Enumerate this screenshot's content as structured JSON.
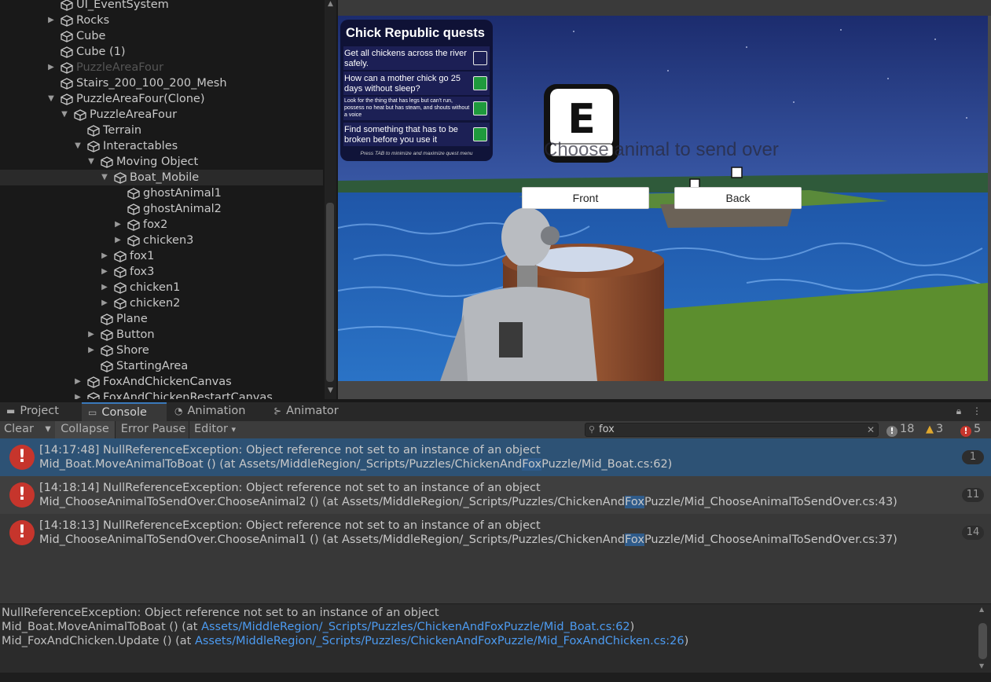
{
  "hierarchy": {
    "items": [
      {
        "label": "UI_EventSystem",
        "indent": 0,
        "arrow": "",
        "dim": false,
        "selected": false
      },
      {
        "label": "Rocks",
        "indent": 0,
        "arrow": "▶",
        "dim": false,
        "selected": false
      },
      {
        "label": "Cube",
        "indent": 0,
        "arrow": "",
        "dim": false,
        "selected": false
      },
      {
        "label": "Cube (1)",
        "indent": 0,
        "arrow": "",
        "dim": false,
        "selected": false
      },
      {
        "label": "PuzzleAreaFour",
        "indent": 0,
        "arrow": "▶",
        "dim": true,
        "selected": false
      },
      {
        "label": "Stairs_200_100_200_Mesh",
        "indent": 0,
        "arrow": "",
        "dim": false,
        "selected": false
      },
      {
        "label": "PuzzleAreaFour(Clone)",
        "indent": 0,
        "arrow": "▼",
        "dim": false,
        "selected": false
      },
      {
        "label": "PuzzleAreaFour",
        "indent": 1,
        "arrow": "▼",
        "dim": false,
        "selected": false
      },
      {
        "label": "Terrain",
        "indent": 2,
        "arrow": "",
        "dim": false,
        "selected": false
      },
      {
        "label": "Interactables",
        "indent": 2,
        "arrow": "▼",
        "dim": false,
        "selected": false
      },
      {
        "label": "Moving Object",
        "indent": 3,
        "arrow": "▼",
        "dim": false,
        "selected": false
      },
      {
        "label": "Boat_Mobile",
        "indent": 4,
        "arrow": "▼",
        "dim": false,
        "selected": true
      },
      {
        "label": "ghostAnimal1",
        "indent": 5,
        "arrow": "",
        "dim": false,
        "selected": false
      },
      {
        "label": "ghostAnimal2",
        "indent": 5,
        "arrow": "",
        "dim": false,
        "selected": false
      },
      {
        "label": "fox2",
        "indent": 5,
        "arrow": "▶",
        "dim": false,
        "selected": false
      },
      {
        "label": "chicken3",
        "indent": 5,
        "arrow": "▶",
        "dim": false,
        "selected": false
      },
      {
        "label": "fox1",
        "indent": 4,
        "arrow": "▶",
        "dim": false,
        "selected": false
      },
      {
        "label": "fox3",
        "indent": 4,
        "arrow": "▶",
        "dim": false,
        "selected": false
      },
      {
        "label": "chicken1",
        "indent": 4,
        "arrow": "▶",
        "dim": false,
        "selected": false
      },
      {
        "label": "chicken2",
        "indent": 4,
        "arrow": "▶",
        "dim": false,
        "selected": false
      },
      {
        "label": "Plane",
        "indent": 3,
        "arrow": "",
        "dim": false,
        "selected": false
      },
      {
        "label": "Button",
        "indent": 3,
        "arrow": "▶",
        "dim": false,
        "selected": false
      },
      {
        "label": "Shore",
        "indent": 3,
        "arrow": "▶",
        "dim": false,
        "selected": false
      },
      {
        "label": "StartingArea",
        "indent": 3,
        "arrow": "",
        "dim": false,
        "selected": false
      },
      {
        "label": "FoxAndChickenCanvas",
        "indent": 2,
        "arrow": "▶",
        "dim": false,
        "selected": false
      },
      {
        "label": "FoxAndChickenRestartCanvas",
        "indent": 2,
        "arrow": "▶",
        "dim": false,
        "selected": false
      }
    ]
  },
  "game": {
    "quest_panel": {
      "title": "Chick Republic quests",
      "quests": [
        {
          "text": "Get all chickens across the river safely.",
          "checked": false,
          "small": false
        },
        {
          "text": "How can a mother chick go 25 days without sleep?",
          "checked": true,
          "small": false
        },
        {
          "text": "Look for the thing that has legs but can't run, possess no heat but has steam, and shouts without a voice",
          "checked": true,
          "small": true
        },
        {
          "text": "Find something that has to be broken before you use it",
          "checked": true,
          "small": false
        }
      ],
      "hint": "Press TAB to minimize and maximize quest menu"
    },
    "key_prompt": "E",
    "prompt_text": "Choose animal to send over",
    "front_button": "Front",
    "back_button": "Back"
  },
  "tabs": [
    {
      "label": "Project",
      "icon": "folder-icon",
      "glyph": "▬",
      "active": false
    },
    {
      "label": "Console",
      "icon": "console-icon",
      "glyph": "▭",
      "active": true
    },
    {
      "label": "Animation",
      "icon": "animation-icon",
      "glyph": "◔",
      "active": false
    },
    {
      "label": "Animator",
      "icon": "animator-icon",
      "glyph": "⊱",
      "active": false
    }
  ],
  "toolbar": {
    "clear": "Clear",
    "collapse": "Collapse",
    "error_pause": "Error Pause",
    "editor": "Editor",
    "search_value": "fox",
    "info_count": "18",
    "warn_count": "3",
    "error_count": "5"
  },
  "logs": [
    {
      "line1": "[14:17:48] NullReferenceException: Object reference not set to an instance of an object",
      "line2_pre": "Mid_Boat.MoveAnimalToBoat () (at Assets/MiddleRegion/_Scripts/Puzzles/ChickenAnd",
      "line2_hl": "Fox",
      "line2_post": "Puzzle/Mid_Boat.cs:62)",
      "count": "1"
    },
    {
      "line1": "[14:18:14] NullReferenceException: Object reference not set to an instance of an object",
      "line2_pre": "Mid_ChooseAnimalToSendOver.ChooseAnimal2 () (at Assets/MiddleRegion/_Scripts/Puzzles/ChickenAnd",
      "line2_hl": "Fox",
      "line2_post": "Puzzle/Mid_ChooseAnimalToSendOver.cs:43)",
      "count": "11"
    },
    {
      "line1": "[14:18:13] NullReferenceException: Object reference not set to an instance of an object",
      "line2_pre": "Mid_ChooseAnimalToSendOver.ChooseAnimal1 () (at Assets/MiddleRegion/_Scripts/Puzzles/ChickenAnd",
      "line2_hl": "Fox",
      "line2_post": "Puzzle/Mid_ChooseAnimalToSendOver.cs:37)",
      "count": "14"
    }
  ],
  "detail": {
    "line1": "NullReferenceException: Object reference not set to an instance of an object",
    "line2_pre": "Mid_Boat.MoveAnimalToBoat () (at ",
    "line2_link": "Assets/MiddleRegion/_Scripts/Puzzles/ChickenAndFoxPuzzle/Mid_Boat.cs:62",
    "line2_post": ")",
    "line3_pre": "Mid_FoxAndChicken.Update () (at ",
    "line3_link": "Assets/MiddleRegion/_Scripts/Puzzles/ChickenAndFoxPuzzle/Mid_FoxAndChicken.cs:26",
    "line3_post": ")"
  },
  "colors": {
    "accent": "#3a79bb",
    "error": "#c6352c",
    "warning": "#e0a82e",
    "quest_check": "#1f9a3d",
    "link": "#4c9bf1"
  }
}
